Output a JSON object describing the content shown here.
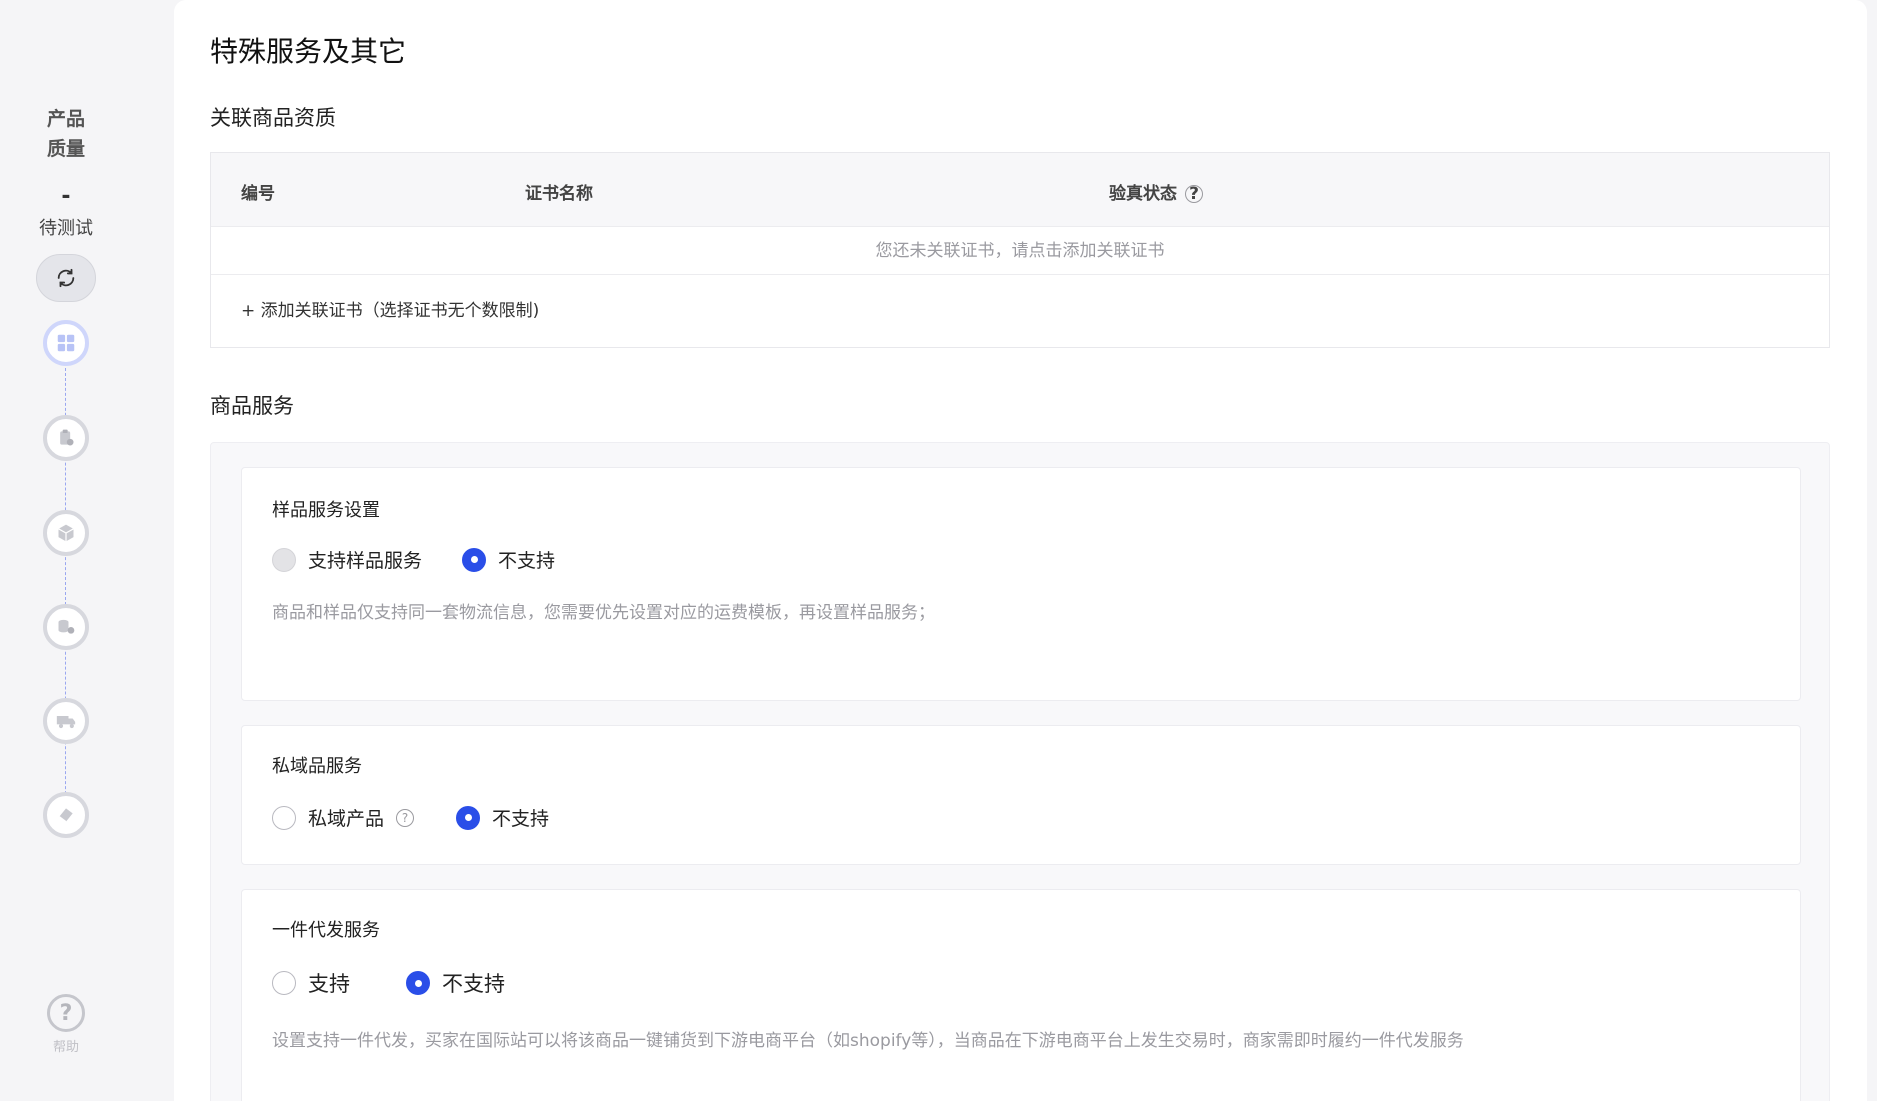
{
  "sidebar": {
    "quality_line1": "产品",
    "quality_line2": "质量",
    "score": "-",
    "status": "待测试",
    "help_label": "帮助",
    "steps": [
      "layout-grid-icon",
      "clipboard-icon",
      "package-box-icon",
      "coins-icon",
      "truck-icon",
      "layers-icon"
    ]
  },
  "page": {
    "title": "特殊服务及其它"
  },
  "certs": {
    "section_title": "关联商品资质",
    "columns": [
      "编号",
      "证书名称",
      "验真状态"
    ],
    "empty_text": "您还未关联证书，请点击添加关联证书",
    "add_link": "+ 添加关联证书（选择证书无个数限制)"
  },
  "services": {
    "section_title": "商品服务",
    "sample": {
      "title": "样品服务设置",
      "option_support": "支持样品服务",
      "option_no": "不支持",
      "selected": "不支持",
      "hint": "商品和样品仅支持同一套物流信息，您需要优先设置对应的运费模板，再设置样品服务；"
    },
    "private": {
      "title": "私域品服务",
      "option_support": "私域产品",
      "option_no": "不支持",
      "selected": "不支持"
    },
    "dropship": {
      "title": "一件代发服务",
      "option_support": "支持",
      "option_no": "不支持",
      "selected": "不支持",
      "hint": "设置支持一件代发，买家在国际站可以将该商品一键铺货到下游电商平台（如shopify等），当商品在下游电商平台上发生交易时，商家需即时履约一件代发服务"
    }
  },
  "colors": {
    "accent": "#2a4ee8",
    "muted_text": "#9a9aa0",
    "rail_bg": "#f5f5f7"
  }
}
